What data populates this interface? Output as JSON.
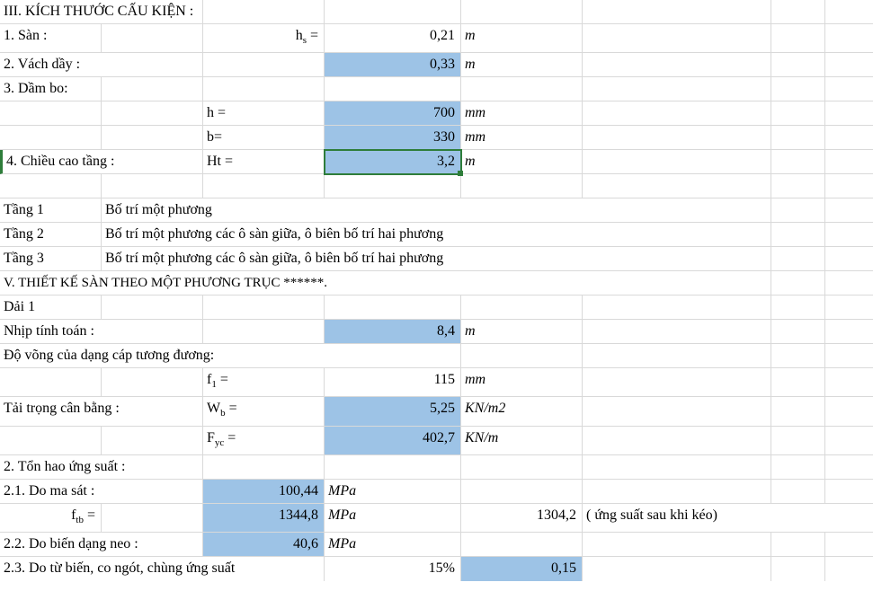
{
  "section3_title": "III. KÍCH THƯỚC CẤU KIỆN :",
  "row_san": {
    "label": "1. Sàn :",
    "sym": "hₛ =",
    "val": "0,21",
    "unit": "m"
  },
  "row_vach": {
    "label": "2. Vách dầy  :",
    "val": "0,33",
    "unit": "m"
  },
  "row_dambo": {
    "label": "3. Dầm bo:"
  },
  "row_h": {
    "sym": "h =",
    "val": "700",
    "unit": "mm"
  },
  "row_b": {
    "sym": "b=",
    "val": "330",
    "unit": "mm"
  },
  "row_ht": {
    "label": "4. Chiều cao tầng :",
    "sym": "Ht =",
    "val": "3,2",
    "unit": "m"
  },
  "tang1": {
    "k": "Tầng 1",
    "v": "Bố trí một phương"
  },
  "tang2": {
    "k": "Tầng 2",
    "v": "Bố trí một phương các ô sàn giữa, ô biên bố trí hai phương"
  },
  "tang3": {
    "k": "Tầng 3",
    "v": "Bố trí một phương các ô sàn giữa, ô biên bố trí hai phương"
  },
  "section5_title": "V. THIẾT KẾ SÀN THEO MỘT PHƯƠNG TRỤC ******.",
  "dai1": "Dải 1",
  "nhip": {
    "label": "Nhịp tính toán :",
    "val": "8,4",
    "unit": "m"
  },
  "dovong": "Độ võng của dạng cáp tương đương:",
  "f1": {
    "sym": "f₁ =",
    "val": "115",
    "unit": "mm"
  },
  "wb": {
    "label": "Tải trọng cân bằng :",
    "sym": "Wᵦ =",
    "val": "5,25",
    "unit": "KN/m2"
  },
  "fyc": {
    "sym": "Fyc =",
    "val": "402,7",
    "unit": "KN/m"
  },
  "tonhao": "2. Tổn hao ứng suất :",
  "masat": {
    "label": "2.1. Do ma sát :",
    "val": "100,44",
    "unit": "MPa"
  },
  "ftb": {
    "sym": "fₜb =",
    "val": "1344,8",
    "unit": "MPa",
    "val2": "1304,2",
    "note": "( ứng suất sau khi kéo)"
  },
  "biendang": {
    "label": "2.2. Do biến dạng neo :",
    "val": "40,6",
    "unit": "MPa"
  },
  "tubien": {
    "label": "2.3. Do từ biến, co ngót, chùng ứng suất",
    "pct": "15%",
    "val": "0,15"
  }
}
